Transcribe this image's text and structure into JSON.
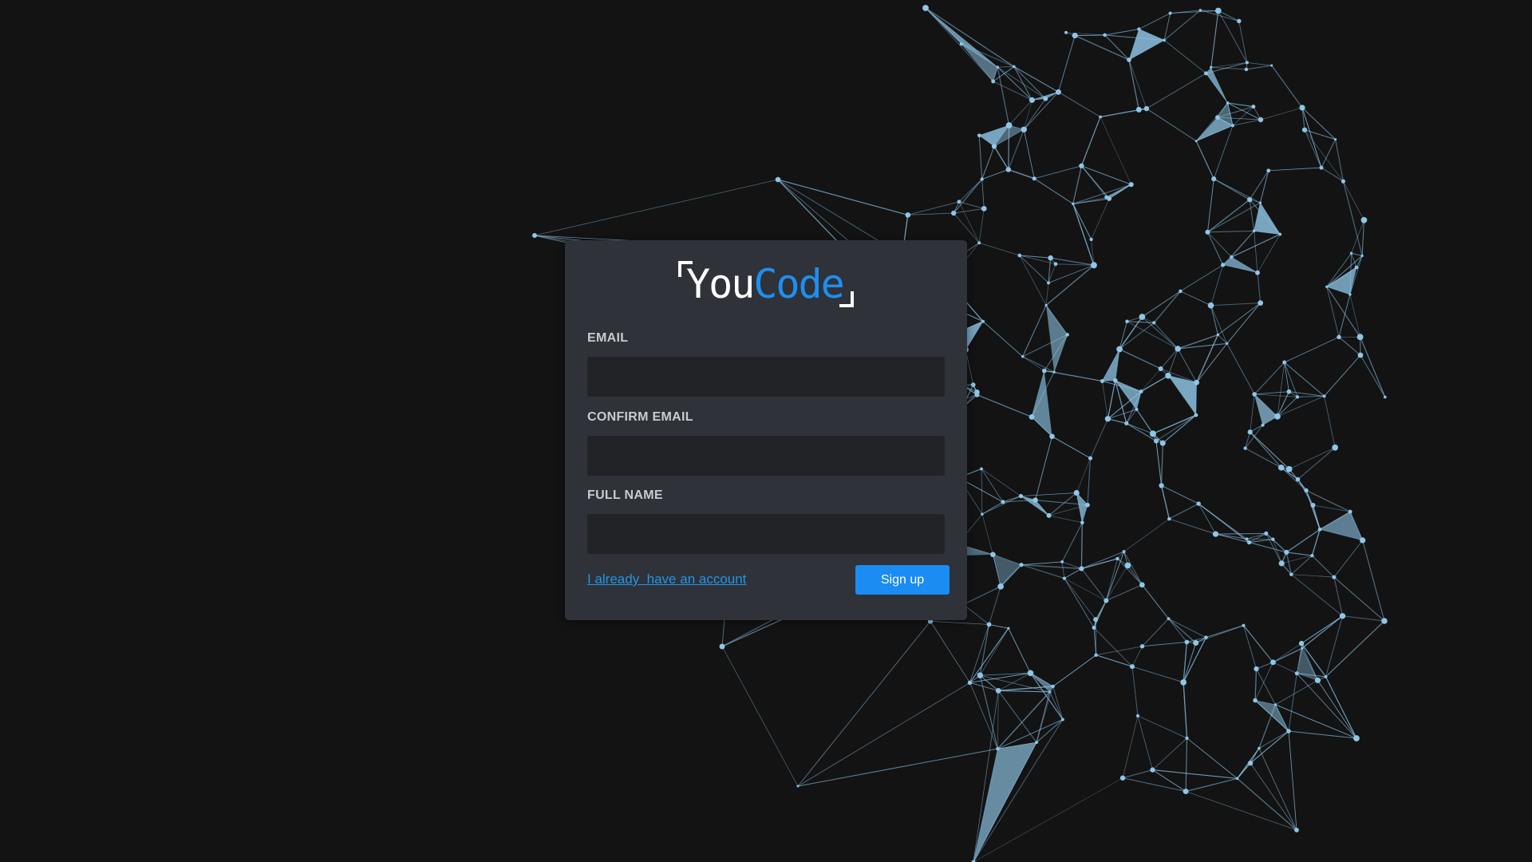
{
  "app": {
    "logo_part1": "You",
    "logo_part2": "Code",
    "logo_colors": {
      "part1": "#ffffff",
      "part2": "#1e8ff2"
    }
  },
  "form": {
    "email_label": "EMAIL",
    "email_value": "",
    "confirm_email_label": "CONFIRM EMAIL",
    "confirm_email_value": "",
    "full_name_label": "FULL NAME",
    "full_name_value": "",
    "login_link": "I already  have an account",
    "signup_button": "Sign up"
  },
  "theme": {
    "background": "#131314",
    "card": "#2f3238",
    "input": "#222327",
    "accent": "#1a8cf2",
    "network": "#8fc6e6"
  },
  "decorations": {
    "background_icon": "polygon-network-icon"
  }
}
